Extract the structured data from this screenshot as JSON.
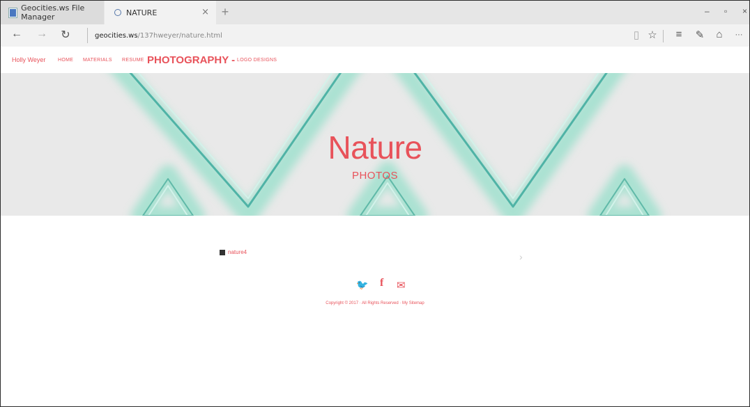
{
  "browser": {
    "tabs": [
      {
        "label": "Geocities.ws File Manager",
        "favicon": "geocities-favicon-icon"
      },
      {
        "label": "NATURE",
        "favicon": "loading-globe-icon"
      }
    ],
    "tab_close": "×",
    "new_tab": "+",
    "window_controls": {
      "minimize": "–",
      "restore": "▫",
      "close": "×"
    },
    "nav": {
      "back": "←",
      "forward": "→",
      "refresh": "↻"
    },
    "url": {
      "host": "geocities.ws",
      "path": "/137hweyer/nature.html"
    },
    "toolbar": {
      "reading_view": "▯",
      "favorite": "☆",
      "hub": "≡",
      "web_note": "✎",
      "share": "⌂",
      "more": "···"
    }
  },
  "site": {
    "nav": {
      "brand": "Holly Weyer",
      "items": [
        "HOME",
        "MATERIALS",
        "RESUME"
      ],
      "active": "PHOTOGRAPHY -",
      "last": "LOGO DESIGNS"
    },
    "hero": {
      "title": "Nature",
      "subtitle": "PHOTOS"
    },
    "gallery": {
      "image_alt": "nature4",
      "next": "›"
    },
    "social": {
      "twitter": "🐦",
      "facebook": "f",
      "email": "✉"
    },
    "footer": {
      "copyright": "Copyright © 2017 · All Rights Reserved · My Sitemap"
    },
    "accent_color": "#e8525a"
  }
}
